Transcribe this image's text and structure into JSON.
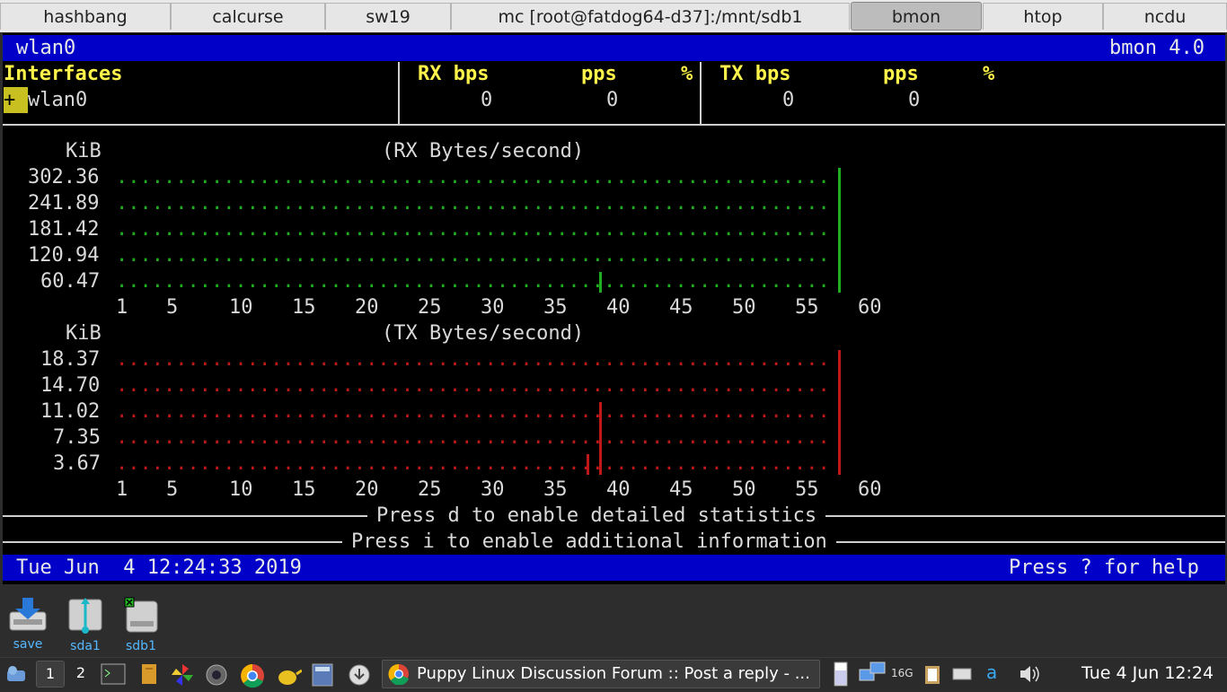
{
  "tabs": [
    {
      "label": "hashbang",
      "active": false
    },
    {
      "label": "calcurse",
      "active": false
    },
    {
      "label": "sw19",
      "active": false
    },
    {
      "label": "mc [root@fatdog64-d37]:/mnt/sdb1",
      "active": false
    },
    {
      "label": "bmon",
      "active": true
    },
    {
      "label": "htop",
      "active": false
    },
    {
      "label": "ncdu",
      "active": false
    }
  ],
  "header": {
    "interface": "wlan0",
    "app": "bmon 4.0"
  },
  "table": {
    "col_interfaces": "Interfaces",
    "col_rx_bps": "RX bps",
    "col_rx_pps": "pps",
    "col_rx_pct": "%",
    "col_tx_bps": "TX bps",
    "col_tx_pps": "pps",
    "col_tx_pct": "%",
    "row": {
      "cursor": "+",
      "name": "wlan0",
      "rx_bps": "0",
      "rx_pps": "0",
      "tx_bps": "0",
      "tx_pps": "0"
    }
  },
  "rx_graph": {
    "unit": "KiB",
    "title": "(RX Bytes/second)",
    "y_labels": [
      "302.36",
      "241.89",
      "181.42",
      "120.94",
      "60.47"
    ],
    "x_labels": [
      "1",
      "5",
      "10",
      "15",
      "20",
      "25",
      "30",
      "35",
      "40",
      "45",
      "50",
      "55",
      "60"
    ],
    "color": "#1fae1f"
  },
  "tx_graph": {
    "unit": "KiB",
    "title": "(TX Bytes/second)",
    "y_labels": [
      "18.37",
      "14.70",
      "11.02",
      "7.35",
      "3.67"
    ],
    "x_labels": [
      "1",
      "5",
      "10",
      "15",
      "20",
      "25",
      "30",
      "35",
      "40",
      "45",
      "50",
      "55",
      "60"
    ],
    "color": "#c01818"
  },
  "hints": {
    "detailed": "Press d to enable detailed statistics",
    "additional": "Press i to enable additional information"
  },
  "status": {
    "datetime": "Tue Jun  4 12:24:33 2019",
    "help": "Press ? for help"
  },
  "desktop_icons": [
    {
      "label": "save",
      "icon": "save-icon"
    },
    {
      "label": "sda1",
      "icon": "usb-drive-icon"
    },
    {
      "label": "sdb1",
      "icon": "hard-drive-icon"
    }
  ],
  "taskbar": {
    "workspaces": [
      "1",
      "2"
    ],
    "window_title": "Puppy Linux Discussion Forum :: Post a reply - ...",
    "memory": "16G",
    "kbd": "a",
    "clock": "Tue 4 Jun 12:24"
  }
}
